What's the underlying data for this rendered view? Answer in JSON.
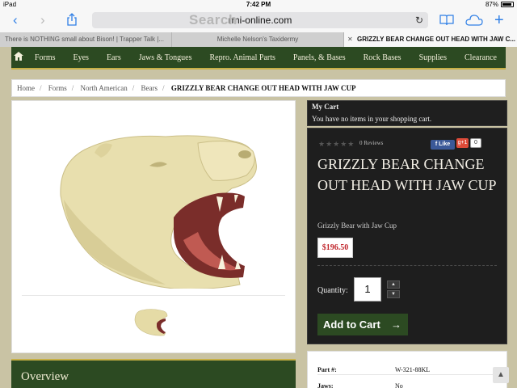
{
  "status_bar": {
    "device": "iPad",
    "time": "7:42 PM",
    "battery": "87%"
  },
  "browser": {
    "url": "rmi-online.com",
    "ghost_text": "Search",
    "tabs": [
      {
        "label": "There is NOTHING small about Bison! | Trapper Talk |..."
      },
      {
        "label": "Michelle Nelson's Taxidermy"
      },
      {
        "label": "GRIZZLY BEAR CHANGE OUT HEAD WITH JAW C..."
      }
    ]
  },
  "nav": {
    "items": [
      "Forms",
      "Eyes",
      "Ears",
      "Jaws & Tongues",
      "Repro. Animal Parts",
      "Panels, & Bases",
      "Rock Bases",
      "Supplies",
      "Clearance"
    ]
  },
  "breadcrumb": {
    "items": [
      "Home",
      "Forms",
      "North American",
      "Bears"
    ],
    "current": "GRIZZLY BEAR CHANGE OUT HEAD WITH JAW CUP"
  },
  "cart": {
    "title": "My Cart",
    "message": "You have no items in your shopping cart."
  },
  "product": {
    "reviews": "0 Reviews",
    "fb_like": "Like",
    "gplus": "g+1",
    "gplus_count": "0",
    "title": "GRIZZLY BEAR CHANGE OUT HEAD WITH JAW CUP",
    "subtitle": "Grizzly Bear with Jaw Cup",
    "price": "$196.50",
    "quantity_label": "Quantity:",
    "quantity_value": "1",
    "add_to_cart": "Add to Cart"
  },
  "overview": {
    "title": "Overview"
  },
  "details": [
    {
      "key": "Part #:",
      "value": "W-321-88KL"
    },
    {
      "key": "Jaws:",
      "value": "No"
    }
  ],
  "colors": {
    "nav_green": "#2c4a22",
    "accent_gold": "#c7b046",
    "price_red": "#c1272d",
    "panel_dark": "#1e1e1e",
    "page_bg": "#c9c3a4"
  }
}
